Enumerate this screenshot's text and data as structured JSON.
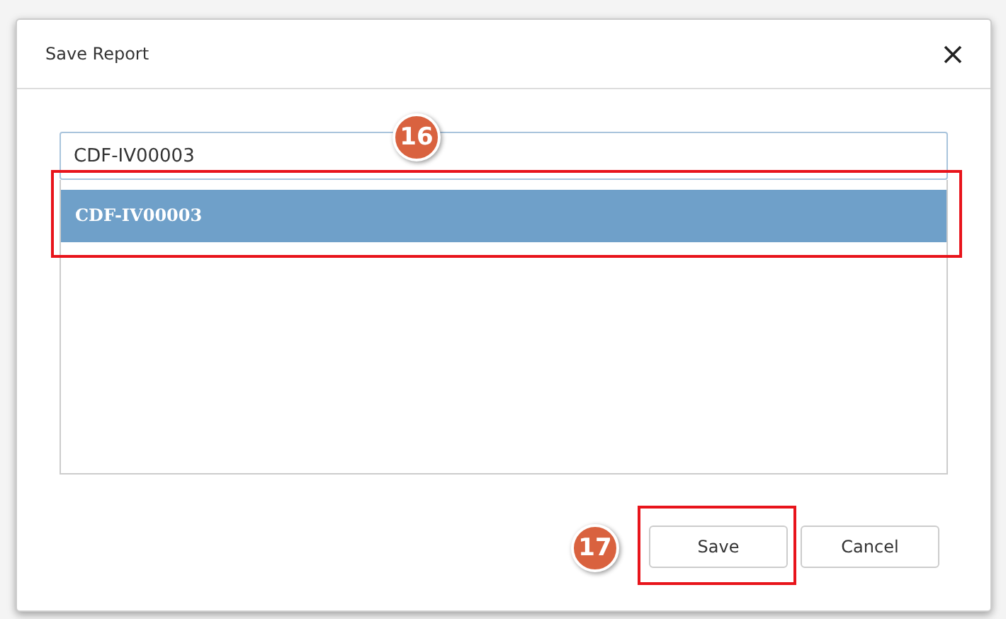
{
  "dialog": {
    "title": "Save Report"
  },
  "name_field": {
    "value": "CDF-IV00003"
  },
  "list": {
    "items": [
      {
        "label": "CDF-IV00003",
        "selected": true
      }
    ]
  },
  "buttons": [
    "Save",
    "Cancel"
  ],
  "callouts": [
    "16",
    "17"
  ]
}
